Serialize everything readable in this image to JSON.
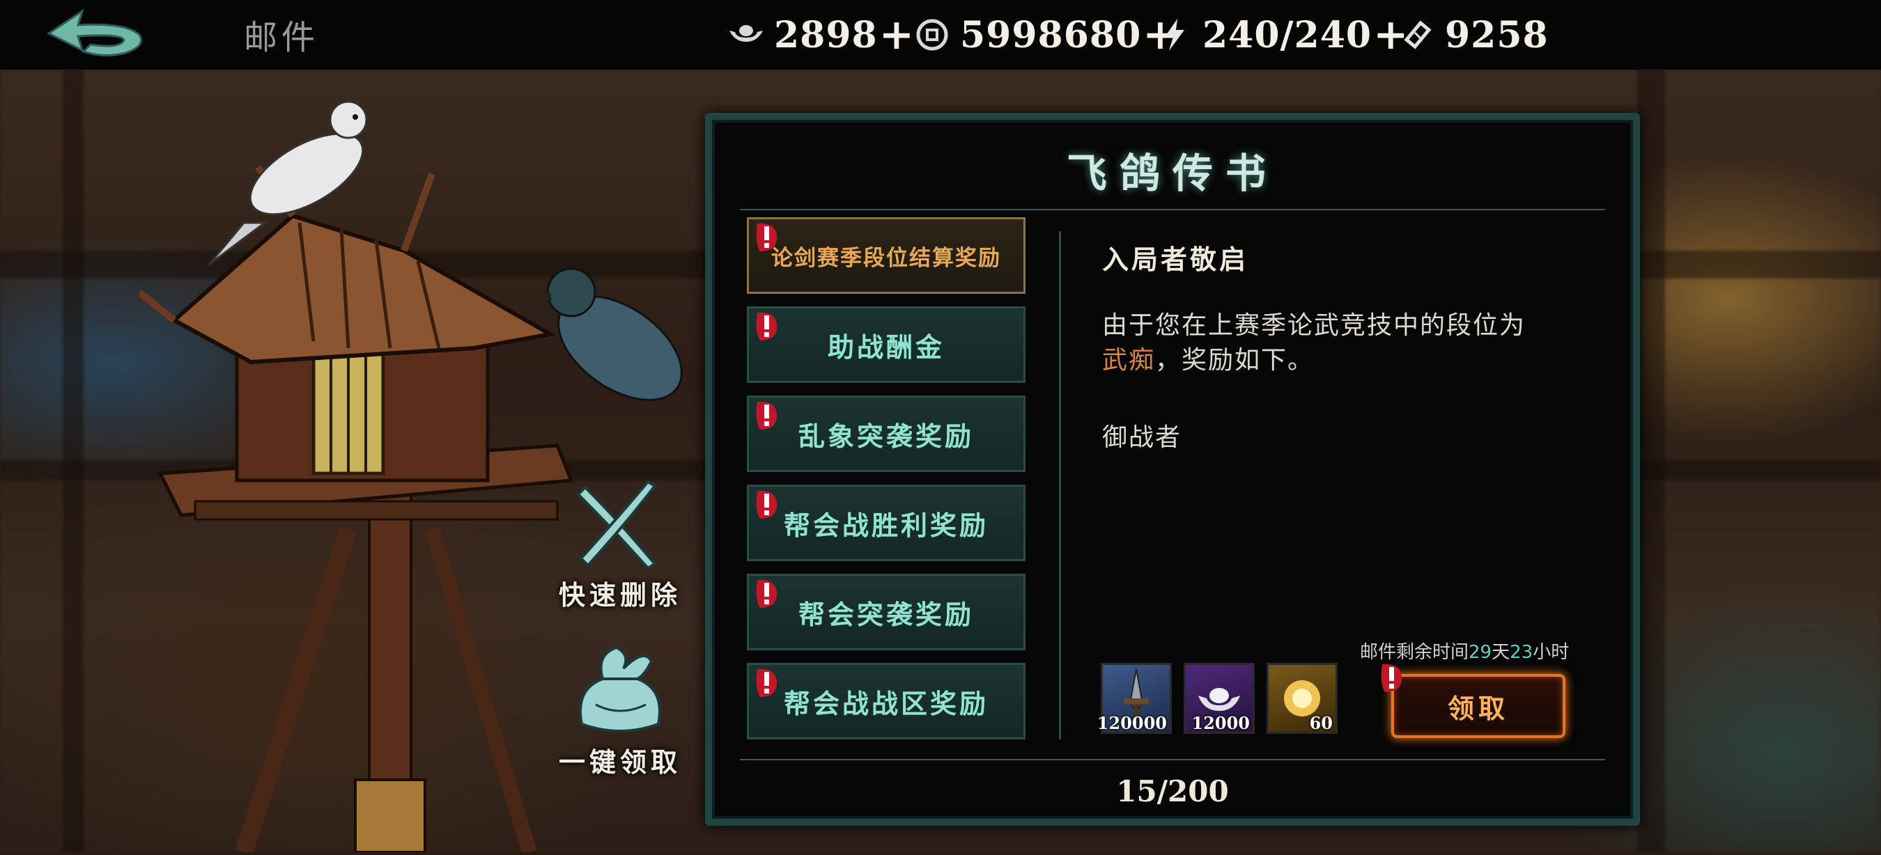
{
  "header": {
    "title": "邮件",
    "resources": [
      {
        "icon": "silver-ingot-icon",
        "value": "2898",
        "plus": "+"
      },
      {
        "icon": "copper-coin-icon",
        "value": "5998680",
        "plus": "+"
      },
      {
        "icon": "lightning-icon",
        "value": "240/240",
        "plus": "+"
      },
      {
        "icon": "ticket-icon",
        "value": "9258"
      }
    ]
  },
  "side_actions": {
    "quick_delete": "快速删除",
    "claim_all": "一键领取"
  },
  "panel": {
    "title": "飞鸽传书",
    "mail_list": [
      {
        "label": "论剑赛季段位结算奖励",
        "selected": true
      },
      {
        "label": "助战酬金"
      },
      {
        "label": "乱象突袭奖励"
      },
      {
        "label": "帮会战胜利奖励"
      },
      {
        "label": "帮会突袭奖励"
      },
      {
        "label": "帮会战战区奖励"
      }
    ],
    "mail": {
      "greeting": "入局者敬启",
      "body_before": "由于您在上赛季论武竞技中的段位为",
      "rank": "武痴",
      "body_after": "，奖励如下。",
      "signature": "御战者",
      "remaining_prefix": "邮件剩余时间",
      "remaining_days": "29",
      "day_unit": "天",
      "remaining_hours": "23",
      "hour_unit": "小时",
      "rewards": [
        {
          "icon": "sword-item-icon",
          "count": "120000",
          "bg": "#2b3f6a"
        },
        {
          "icon": "silver-ingot-icon",
          "count": "12000",
          "bg": "#3a1e5c"
        },
        {
          "icon": "golden-orb-icon",
          "count": "60",
          "bg": "#6a4a12"
        }
      ],
      "claim_label": "领取"
    },
    "page_count": "15/200"
  },
  "colors": {
    "accent_teal": "#8fe3cf",
    "rank_orange": "#d98645",
    "claim_orange": "#e0762a"
  }
}
